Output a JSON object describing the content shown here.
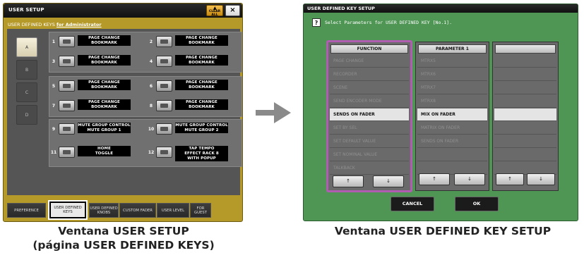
{
  "left_window": {
    "title": "USER SETUP",
    "clear_all_label": "CLEAR ALL",
    "close_label": "×",
    "subtitle_prefix": "USER DEFINED KEYS",
    "subtitle_user": "for Administrator",
    "pages": [
      "A",
      "B",
      "C",
      "D"
    ],
    "active_page": "A",
    "keys": [
      {
        "num": "1",
        "label": [
          "PAGE CHANGE",
          "BOOKMARK"
        ]
      },
      {
        "num": "2",
        "label": [
          "PAGE CHANGE",
          "BOOKMARK"
        ]
      },
      {
        "num": "3",
        "label": [
          "PAGE CHANGE",
          "BOOKMARK"
        ]
      },
      {
        "num": "4",
        "label": [
          "PAGE CHANGE",
          "BOOKMARK"
        ]
      },
      {
        "num": "5",
        "label": [
          "PAGE CHANGE",
          "BOOKMARK"
        ]
      },
      {
        "num": "6",
        "label": [
          "PAGE CHANGE",
          "BOOKMARK"
        ]
      },
      {
        "num": "7",
        "label": [
          "PAGE CHANGE",
          "BOOKMARK"
        ]
      },
      {
        "num": "8",
        "label": [
          "PAGE CHANGE",
          "BOOKMARK"
        ]
      },
      {
        "num": "9",
        "label": [
          "MUTE GROUP CONTROL",
          "MUTE GROUP 1"
        ]
      },
      {
        "num": "10",
        "label": [
          "MUTE GROUP CONTROL",
          "MUTE GROUP 2"
        ]
      },
      {
        "num": "11",
        "label": [
          "HOME",
          "TOGGLE"
        ]
      },
      {
        "num": "12",
        "label": [
          "TAP TEMPO",
          "EFFECT RACK 8",
          "WITH POPUP"
        ]
      }
    ],
    "tabs": [
      "PREFERENCE",
      "USER DEFINED KEYS",
      "USER DEFINED KNOBS",
      "CUSTOM FADER",
      "USER LEVEL",
      "FOR GUEST"
    ],
    "active_tab": "USER DEFINED KEYS"
  },
  "right_window": {
    "title": "USER DEFINED KEY SETUP",
    "help_icon_label": "?",
    "instruction": "Select Parameters for USER DEFINED KEY [No.1].",
    "function_header": "FUNCTION",
    "function_items": [
      "PAGE CHANGE",
      "RECORDER",
      "SCENE",
      "SEND ENCODER MODE",
      "SENDS ON FADER",
      "SET BY SEL",
      "SET DEFAULT VALUE",
      "SET NOMINAL VALUE",
      "TALKBACK"
    ],
    "function_selected": "SENDS ON FADER",
    "param1_header": "PARAMETER 1",
    "param1_items": [
      "MTRX5",
      "MTRX6",
      "MTRX7",
      "MTRX8",
      "MIX ON FADER",
      "MATRIX ON FADER",
      "SENDS ON FADER"
    ],
    "param1_selected": "MIX ON FADER",
    "param2_header": "",
    "up_label": "↑",
    "down_label": "↓",
    "cancel_label": "CANCEL",
    "ok_label": "OK"
  },
  "captions": {
    "left": [
      "Ventana USER SETUP",
      "(página USER DEFINED KEYS)"
    ],
    "right": "Ventana USER DEFINED KEY SETUP"
  },
  "colors": {
    "left_window_bg": "#b59a2a",
    "right_window_bg": "#4f9655",
    "function_column_border": "#b05cb0",
    "arrow": "#8a8a8a"
  }
}
